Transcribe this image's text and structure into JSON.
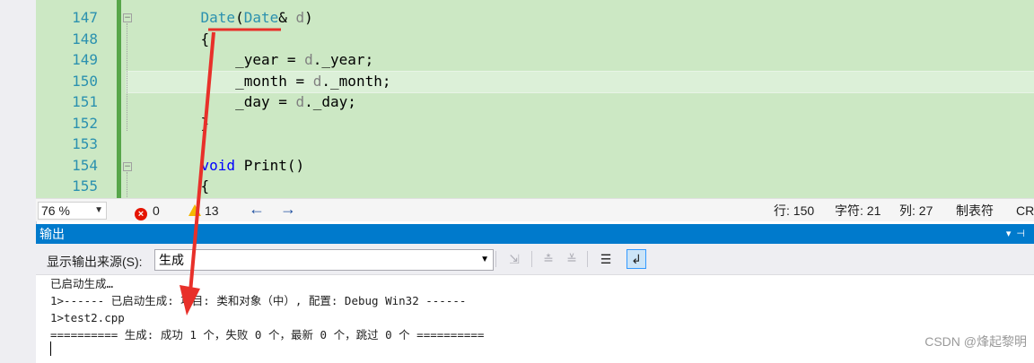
{
  "editor": {
    "line_numbers": [
      "147",
      "148",
      "149",
      "150",
      "151",
      "152",
      "153",
      "154",
      "155"
    ],
    "lines": [
      {
        "indent": "    ",
        "parts": [
          [
            "type",
            "Date"
          ],
          [
            "plain",
            "("
          ],
          [
            "type",
            "Date"
          ],
          [
            "plain",
            "& "
          ],
          [
            "param",
            "d"
          ],
          [
            "plain",
            ")"
          ]
        ]
      },
      {
        "indent": "    ",
        "parts": [
          [
            "plain",
            "{"
          ]
        ]
      },
      {
        "indent": "        ",
        "parts": [
          [
            "plain",
            "_year = "
          ],
          [
            "param",
            "d"
          ],
          [
            "plain",
            "._year;"
          ]
        ]
      },
      {
        "indent": "        ",
        "parts": [
          [
            "plain",
            "_month = "
          ],
          [
            "param",
            "d"
          ],
          [
            "plain",
            "._month;"
          ]
        ]
      },
      {
        "indent": "        ",
        "parts": [
          [
            "plain",
            "_day = "
          ],
          [
            "param",
            "d"
          ],
          [
            "plain",
            "._day;"
          ]
        ]
      },
      {
        "indent": "    ",
        "parts": [
          [
            "plain",
            "}"
          ]
        ]
      },
      {
        "indent": "",
        "parts": []
      },
      {
        "indent": "    ",
        "parts": [
          [
            "kw",
            "void"
          ],
          [
            "plain",
            " Print()"
          ]
        ]
      },
      {
        "indent": "    ",
        "parts": [
          [
            "plain",
            "{"
          ]
        ]
      }
    ],
    "current_line_index": 3
  },
  "statusbar": {
    "zoom": "76 %",
    "errors": "0",
    "warnings": "13",
    "line": "行: 150",
    "char": "字符: 21",
    "col": "列: 27",
    "tabs": "制表符",
    "eol": "CRLF"
  },
  "output": {
    "title": "输出",
    "source_label": "显示输出来源(S):",
    "source_value": "生成",
    "lines": [
      "已启动生成…",
      "1>------ 已启动生成: 项目: 类和对象（中）, 配置: Debug Win32 ------",
      "1>test2.cpp",
      "========== 生成: 成功 1 个，失败 0 个，最新 0 个，跳过 0 个 =========="
    ]
  },
  "watermark": "CSDN @烽起黎明",
  "colors": {
    "editor_bg": "#cce8c4",
    "title_bar": "#007acc",
    "annotation_red": "#e8302a"
  }
}
